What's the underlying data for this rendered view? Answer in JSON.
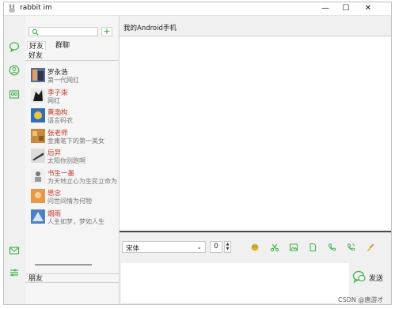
{
  "window": {
    "title": "rabbit im",
    "controls": {
      "minimize": "—",
      "maximize": "☐",
      "close": "✕"
    }
  },
  "rail": {
    "icons": [
      "chat-icon",
      "contacts-icon",
      "group-icon",
      "mail-icon",
      "settings-icon"
    ]
  },
  "friend_panel": {
    "search": {
      "value": "",
      "placeholder": ""
    },
    "add_label": "+",
    "tabs": [
      {
        "label": "好友",
        "active": true
      },
      {
        "label": "群聊",
        "active": false
      }
    ],
    "group_header": "好友",
    "friends": [
      {
        "name": "罗永浩",
        "signature": "第一代网红",
        "name_color": "#222222"
      },
      {
        "name": "李子柒",
        "signature": "网红",
        "name_color": "#c0392b"
      },
      {
        "name": "黄渤构",
        "signature": "语言码农",
        "name_color": "#c0392b"
      },
      {
        "name": "张老师",
        "signature": "金庸笔下的第一美女",
        "name_color": "#c0392b"
      },
      {
        "name": "后羿",
        "signature": "太阳你别跑啊",
        "name_color": "#c0392b"
      },
      {
        "name": "书生一墨",
        "signature": "为天地立心为生民立命为往",
        "name_color": "#c0392b"
      },
      {
        "name": "思念",
        "signature": "问世间情为何物",
        "name_color": "#c0392b"
      },
      {
        "name": "烟雨",
        "signature": "人生如梦，梦如人生",
        "name_color": "#c0392b"
      }
    ],
    "footer_group": "朋友"
  },
  "chat": {
    "title": "我的Android手机",
    "toolbar": {
      "font": "宋体",
      "size": "0",
      "tools": [
        "emoji-icon",
        "scissors-icon",
        "image-icon",
        "file-icon",
        "phone-icon",
        "call-icon",
        "brush-icon"
      ]
    },
    "send_label": "发送"
  },
  "watermark": "CSDN @唐游才",
  "colors": {
    "accent": "#2aa52a",
    "name_red": "#c0392b",
    "divider": "#4a4a4a"
  }
}
